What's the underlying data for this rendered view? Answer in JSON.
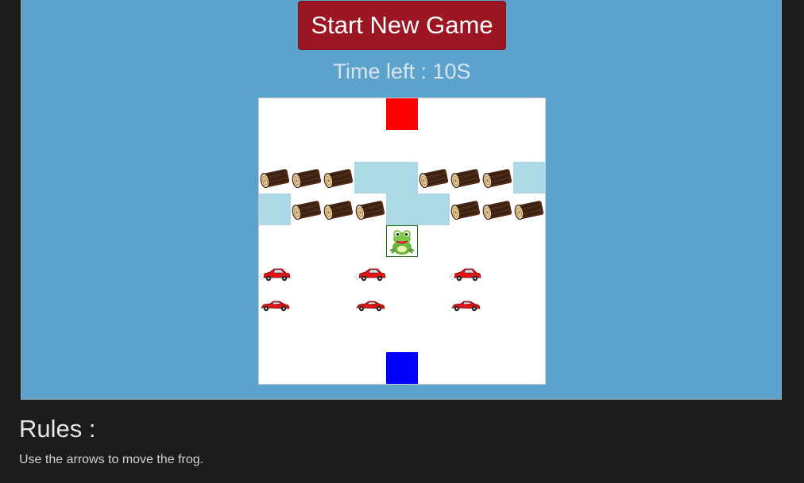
{
  "game": {
    "start_button_label": "Start New Game",
    "timer_text": "Time left : 10S",
    "grid": {
      "columns": 9,
      "rows": 9,
      "rows_layout": [
        [
          "empty",
          "empty",
          "empty",
          "empty",
          "goal",
          "empty",
          "empty",
          "empty",
          "empty"
        ],
        [
          "empty",
          "empty",
          "empty",
          "empty",
          "empty",
          "empty",
          "empty",
          "empty",
          "empty"
        ],
        [
          "log",
          "log",
          "log",
          "water",
          "water",
          "log",
          "log",
          "log",
          "water"
        ],
        [
          "water",
          "log",
          "log",
          "log",
          "water",
          "water",
          "log",
          "log",
          "log"
        ],
        [
          "empty",
          "empty",
          "empty",
          "empty",
          "frog",
          "empty",
          "empty",
          "empty",
          "empty"
        ],
        [
          "car-left",
          "empty",
          "empty",
          "car-left",
          "empty",
          "empty",
          "car-left",
          "empty",
          "empty"
        ],
        [
          "car-right",
          "empty",
          "empty",
          "car-right",
          "empty",
          "empty",
          "car-right",
          "empty",
          "empty"
        ],
        [
          "empty",
          "empty",
          "empty",
          "empty",
          "empty",
          "empty",
          "empty",
          "empty",
          "empty"
        ],
        [
          "empty",
          "empty",
          "empty",
          "empty",
          "start",
          "empty",
          "empty",
          "empty",
          "empty"
        ]
      ]
    }
  },
  "rules": {
    "title": "Rules :",
    "text": "Use the arrows to move the frog."
  },
  "colors": {
    "panel_background": "#5ba3cd",
    "page_background": "#1b1c1e",
    "start_button": "#9b1622",
    "goal": "#ff0000",
    "start": "#0000ff",
    "water": "#add8e6",
    "car": "#e01515"
  },
  "icons": {
    "log": "wooden-log-icon",
    "frog": "frog-icon",
    "car": "red-car-icon"
  }
}
